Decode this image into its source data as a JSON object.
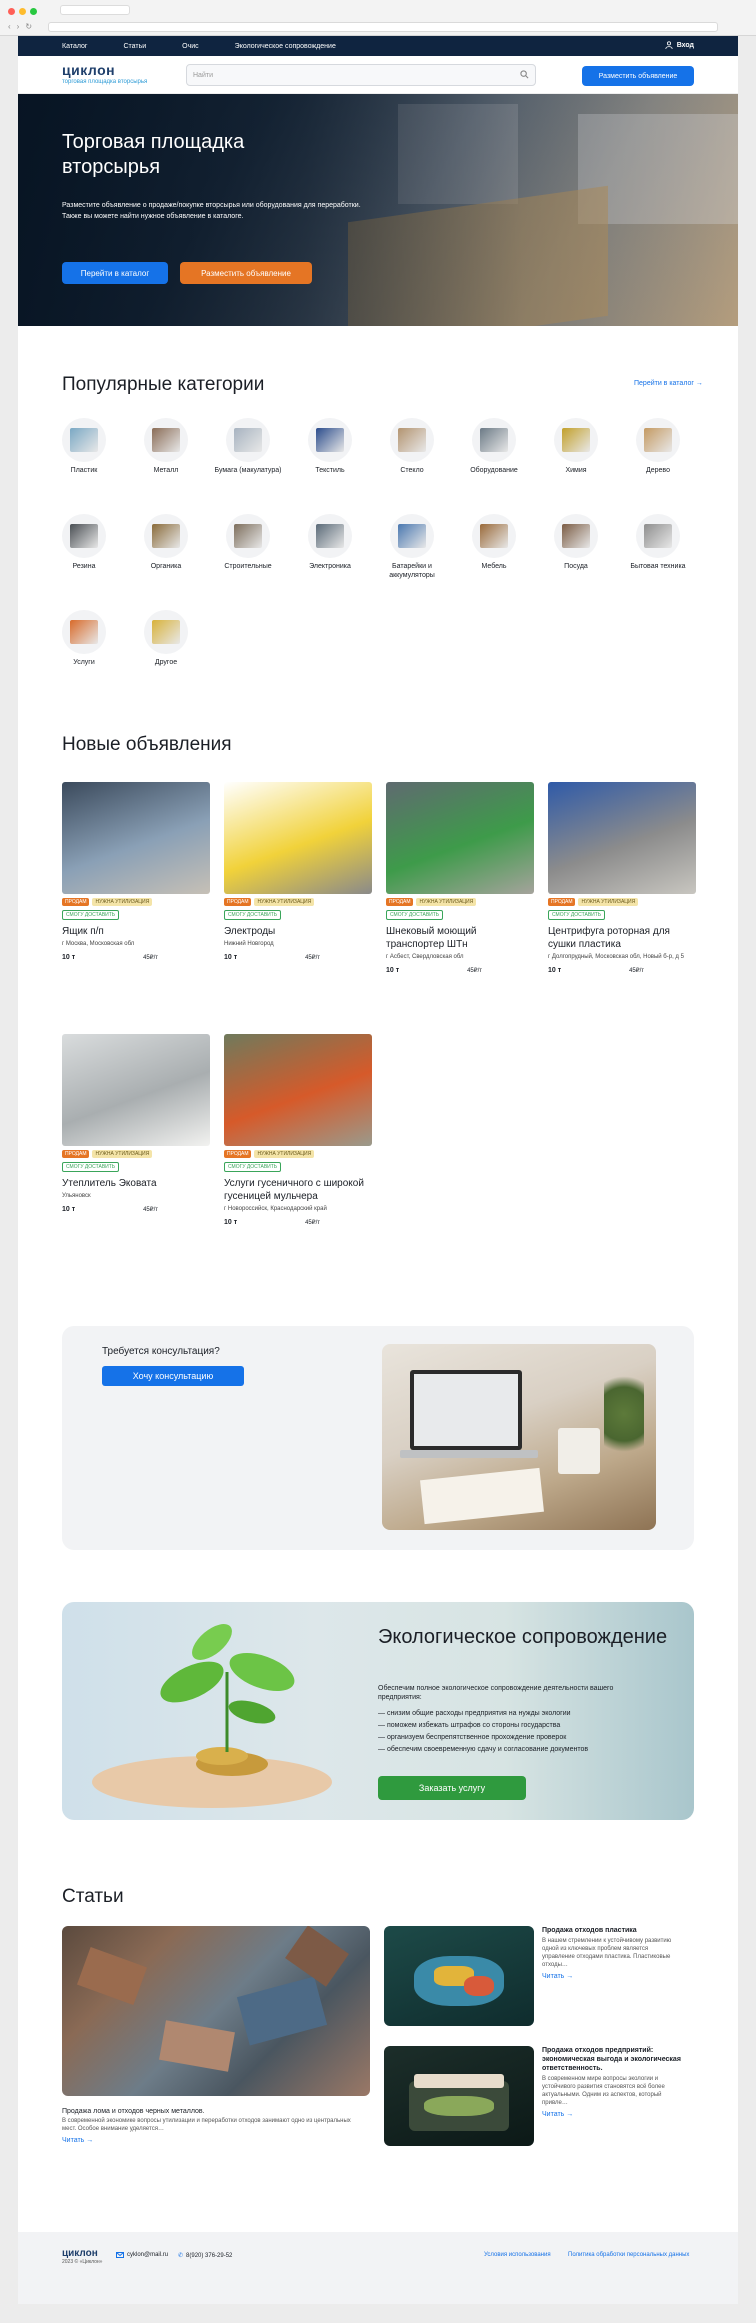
{
  "nav": {
    "items": [
      "Каталог",
      "Статьи",
      "Очис",
      "Экологическое сопровождение"
    ],
    "login": "Вход"
  },
  "header": {
    "logo_text": "циклон",
    "logo_sub": "торговая площадка вторсырья",
    "search_placeholder": "Найти",
    "post_button": "Разместить объявление"
  },
  "hero": {
    "title": "Торговая площадка вторсырья",
    "text": "Разместите объявление о продаже/покупке вторсырья или оборудования для переработки. Также вы можете найти нужное объявление в каталоге.",
    "btn_catalog": "Перейти в каталог",
    "btn_post": "Разместить объявление"
  },
  "categories": {
    "title": "Популярные категории",
    "link": "Перейти в каталог",
    "items": [
      {
        "label": "Пластик",
        "color": "#7aa8c4"
      },
      {
        "label": "Металл",
        "color": "#8a6c56"
      },
      {
        "label": "Бумага (макулатура)",
        "color": "#a7b3c0"
      },
      {
        "label": "Текстиль",
        "color": "#2b4c8c"
      },
      {
        "label": "Стекло",
        "color": "#b39470"
      },
      {
        "label": "Оборудование",
        "color": "#6b7a86"
      },
      {
        "label": "Химия",
        "color": "#c2a02a"
      },
      {
        "label": "Дерево",
        "color": "#c49a62"
      },
      {
        "label": "Резина",
        "color": "#4a4f54"
      },
      {
        "label": "Органика",
        "color": "#8a6b3a"
      },
      {
        "label": "Строительные",
        "color": "#7d6e5c"
      },
      {
        "label": "Электроника",
        "color": "#5a6a78"
      },
      {
        "label": "Батарейки и аккумуляторы",
        "color": "#4a78b0"
      },
      {
        "label": "Мебель",
        "color": "#9a6a3a"
      },
      {
        "label": "Посуда",
        "color": "#7b5c44"
      },
      {
        "label": "Бытовая техника",
        "color": "#8e8e8e"
      },
      {
        "label": "Услуги",
        "color": "#d86a2a"
      },
      {
        "label": "Другое",
        "color": "#d8b23a"
      }
    ]
  },
  "ads": {
    "title": "Новые объявления",
    "tags": {
      "sell": "ПРОДАМ",
      "need": "НУЖНА УТИЛИЗАЦИЯ",
      "delivery": "СМОГУ ДОСТАВИТЬ"
    },
    "items": [
      {
        "title": "Ящик п/п",
        "loc": "г Москва, Московская обл",
        "qty": "10 т",
        "price": "45₽/т",
        "colors": [
          "#3b4a5c",
          "#8aa0b6",
          "#c6c0b6"
        ]
      },
      {
        "title": "Электроды",
        "loc": "Нижний Новгород",
        "qty": "10 т",
        "price": "45₽/т",
        "colors": [
          "#ffffff",
          "#f1d23a",
          "#8a8a8a"
        ]
      },
      {
        "title": "Шнековый моющий транспортер ШТн",
        "loc": "г Асбест, Свердловская обл",
        "qty": "10 т",
        "price": "45₽/т",
        "colors": [
          "#5f6a70",
          "#3e9b4a",
          "#a5a39c"
        ]
      },
      {
        "title": "Центрифуга роторная для сушки пластика",
        "loc": "г Долгопрудный, Московская обл, Новый б-р, д 5",
        "qty": "10 т",
        "price": "45₽/т",
        "colors": [
          "#2f5aa8",
          "#8c8c8c",
          "#c8c6c0"
        ]
      },
      {
        "title": "Утеплитель Эковата",
        "loc": "Ульяновск",
        "qty": "10 т",
        "price": "45₽/т",
        "colors": [
          "#d9dcdd",
          "#a9aeb0",
          "#f2f2f0"
        ]
      },
      {
        "title": "Услуги гусеничного с широкой гусеницей мульчера",
        "loc": "г Новороссийск, Краснодарский край",
        "qty": "10 т",
        "price": "45₽/т",
        "colors": [
          "#6f7a5c",
          "#d65a2a",
          "#9a9a8c"
        ]
      }
    ]
  },
  "consult": {
    "question": "Требуется консультация?",
    "button": "Хочу консультацию"
  },
  "eco": {
    "title": "Экологическое сопровождение",
    "desc": "Обеспечим полное экологическое сопровождение деятельности вашего предприятия:",
    "points": [
      "— снизим общие расходы предприятия на нужды экологии",
      "— поможем избежать штрафов со стороны государства",
      "— организуем беспрепятственное прохождение проверок",
      "— обеспечим своевременную сдачу и согласование документов"
    ],
    "button": "Заказать услугу"
  },
  "articles": {
    "title": "Статьи",
    "read": "Читать",
    "big": {
      "title": "Продажа лома и отходов черных металлов.",
      "desc": "В современной экономике вопросы утилизации и переработки отходов занимают одно из центральных мест. Особое внимание уделяется…"
    },
    "small": [
      {
        "title": "Продажа отходов пластика",
        "desc": "В нашем стремлении к устойчивому развитию одной из ключевых проблем является управление отходами пластика. Пластиковые отходы…"
      },
      {
        "title": "Продажа отходов предприятий: экономическая выгода и экологическая ответственность.",
        "desc": "В современном мире вопросы экологии и устойчивого развития становятся всё более актуальными. Одним из аспектов, который привле…"
      }
    ]
  },
  "footer": {
    "logo": "циклон",
    "copyright": "2023 © «Циклон»",
    "email": "cyklon@mail.ru",
    "phone": "8(920) 376-29-52",
    "terms": "Условия использования",
    "privacy": "Политика обработки персональных данных"
  },
  "colors": {
    "primary": "#1572e8",
    "accent": "#e57524",
    "green": "#2f9a3e",
    "navy": "#0f2440"
  }
}
